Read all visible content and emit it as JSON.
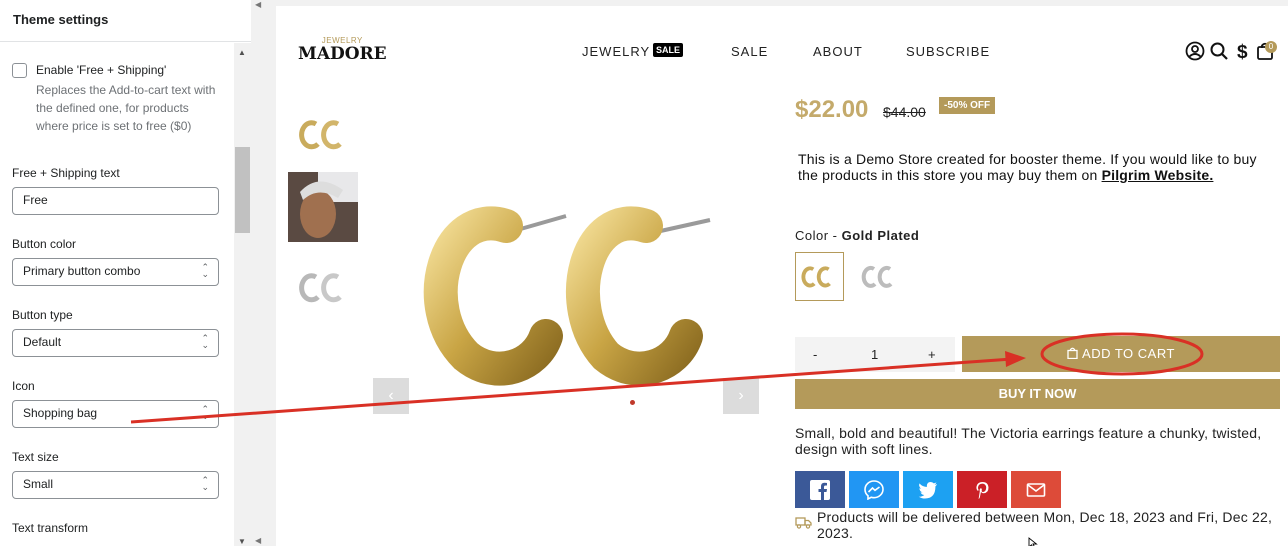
{
  "panel": {
    "title": "Theme settings",
    "checkbox": {
      "label": "Enable 'Free + Shipping'",
      "help": "Replaces the Add-to-cart text with the defined one, for products where price is set to free ($0)"
    },
    "fields": {
      "free_shipping_text": {
        "label": "Free + Shipping text",
        "value": "Free"
      },
      "button_color": {
        "label": "Button color",
        "value": "Primary button combo"
      },
      "button_type": {
        "label": "Button type",
        "value": "Default"
      },
      "icon": {
        "label": "Icon",
        "value": "Shopping bag"
      },
      "text_size": {
        "label": "Text size",
        "value": "Small"
      },
      "text_transform": {
        "label": "Text transform"
      }
    }
  },
  "store": {
    "logo_small": "JEWELRY",
    "logo_big": "MADORE",
    "nav": {
      "jewelry": "JEWELRY",
      "sale_badge": "SALE",
      "sale": "SALE",
      "about": "ABOUT",
      "subscribe": "SUBSCRIBE"
    },
    "cart_count": "0",
    "product": {
      "price": "$22.00",
      "compare_price": "$44.00",
      "discount_badge": "-50% OFF",
      "description": "This is a Demo Store created for booster theme. If you would like to buy the products in this store you may buy them on ",
      "description_link": "Pilgrim Website.",
      "color_label": "Color - ",
      "color_value": "Gold Plated",
      "qty_minus": "-",
      "qty_value": "1",
      "qty_plus": "+",
      "add_to_cart": "ADD TO CART",
      "buy_now": "BUY IT NOW",
      "short_description": "Small, bold and beautiful! The Victoria earrings feature a chunky, twisted, design with soft lines.",
      "delivery": "Products will be delivered between Mon, Dec 18, 2023 and Fri, Dec 22, 2023."
    }
  },
  "colors": {
    "accent": "#b49a5a",
    "price": "#c4aa6b",
    "annotation": "#d93025",
    "facebook": "#3b5998",
    "messenger": "#2196f3",
    "twitter": "#1da1f2",
    "pinterest": "#cb2027",
    "email": "#dd4b39"
  }
}
